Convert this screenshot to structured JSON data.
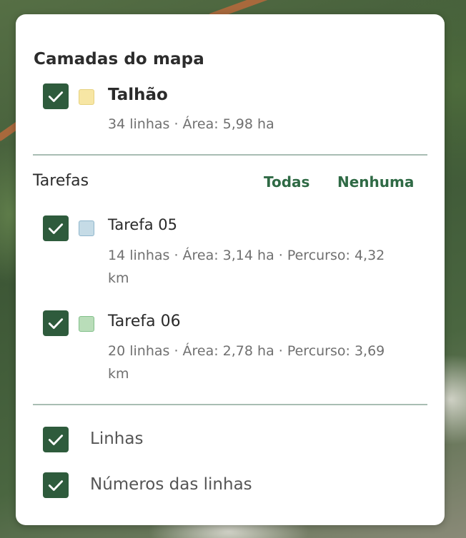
{
  "panel": {
    "title": "Camadas do mapa"
  },
  "field_layer": {
    "name": "Talhão",
    "meta": "34 linhas · Área: 5,98 ha",
    "checked": true,
    "swatch_color": "#f7e6a4"
  },
  "tasks": {
    "label": "Tarefas",
    "all_label": "Todas",
    "none_label": "Nenhuma",
    "items": [
      {
        "name": "Tarefa 05",
        "meta_line1": "14 linhas · Área: 3,14 ha · Percurso: 4,32",
        "meta_line2": "km",
        "checked": true,
        "swatch_color": "#c5dbe6"
      },
      {
        "name": "Tarefa 06",
        "meta_line1": "20 linhas · Área: 2,78 ha · Percurso: 3,69",
        "meta_line2": "km",
        "checked": true,
        "swatch_color": "#b9ddb9"
      }
    ]
  },
  "options": [
    {
      "label": "Linhas",
      "checked": true
    },
    {
      "label": "Números das linhas",
      "checked": true
    }
  ],
  "colors": {
    "checkbox": "#2e5b3c",
    "link": "#2f6a45",
    "divider": "#a9bdb3"
  }
}
